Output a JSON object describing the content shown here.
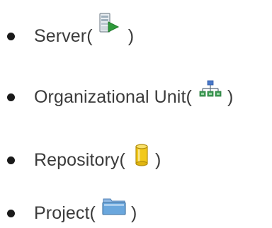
{
  "items": [
    {
      "label": "Server",
      "icon": "server-icon"
    },
    {
      "label": "Organizational Unit",
      "icon": "organizational-unit-icon"
    },
    {
      "label": "Repository",
      "icon": "repository-icon"
    },
    {
      "label": "Project",
      "icon": "project-icon"
    }
  ],
  "punctuation": {
    "open": " (",
    "close": ")"
  },
  "colors": {
    "text": "#3b3b3b",
    "bullet": "#1a1a1a",
    "server_green": "#2e9a3a",
    "org_unit_blue": "#4a78c8",
    "org_unit_green": "#3c9a52",
    "repository_yellow": "#f2c91b",
    "project_blue": "#6aa7dd"
  }
}
